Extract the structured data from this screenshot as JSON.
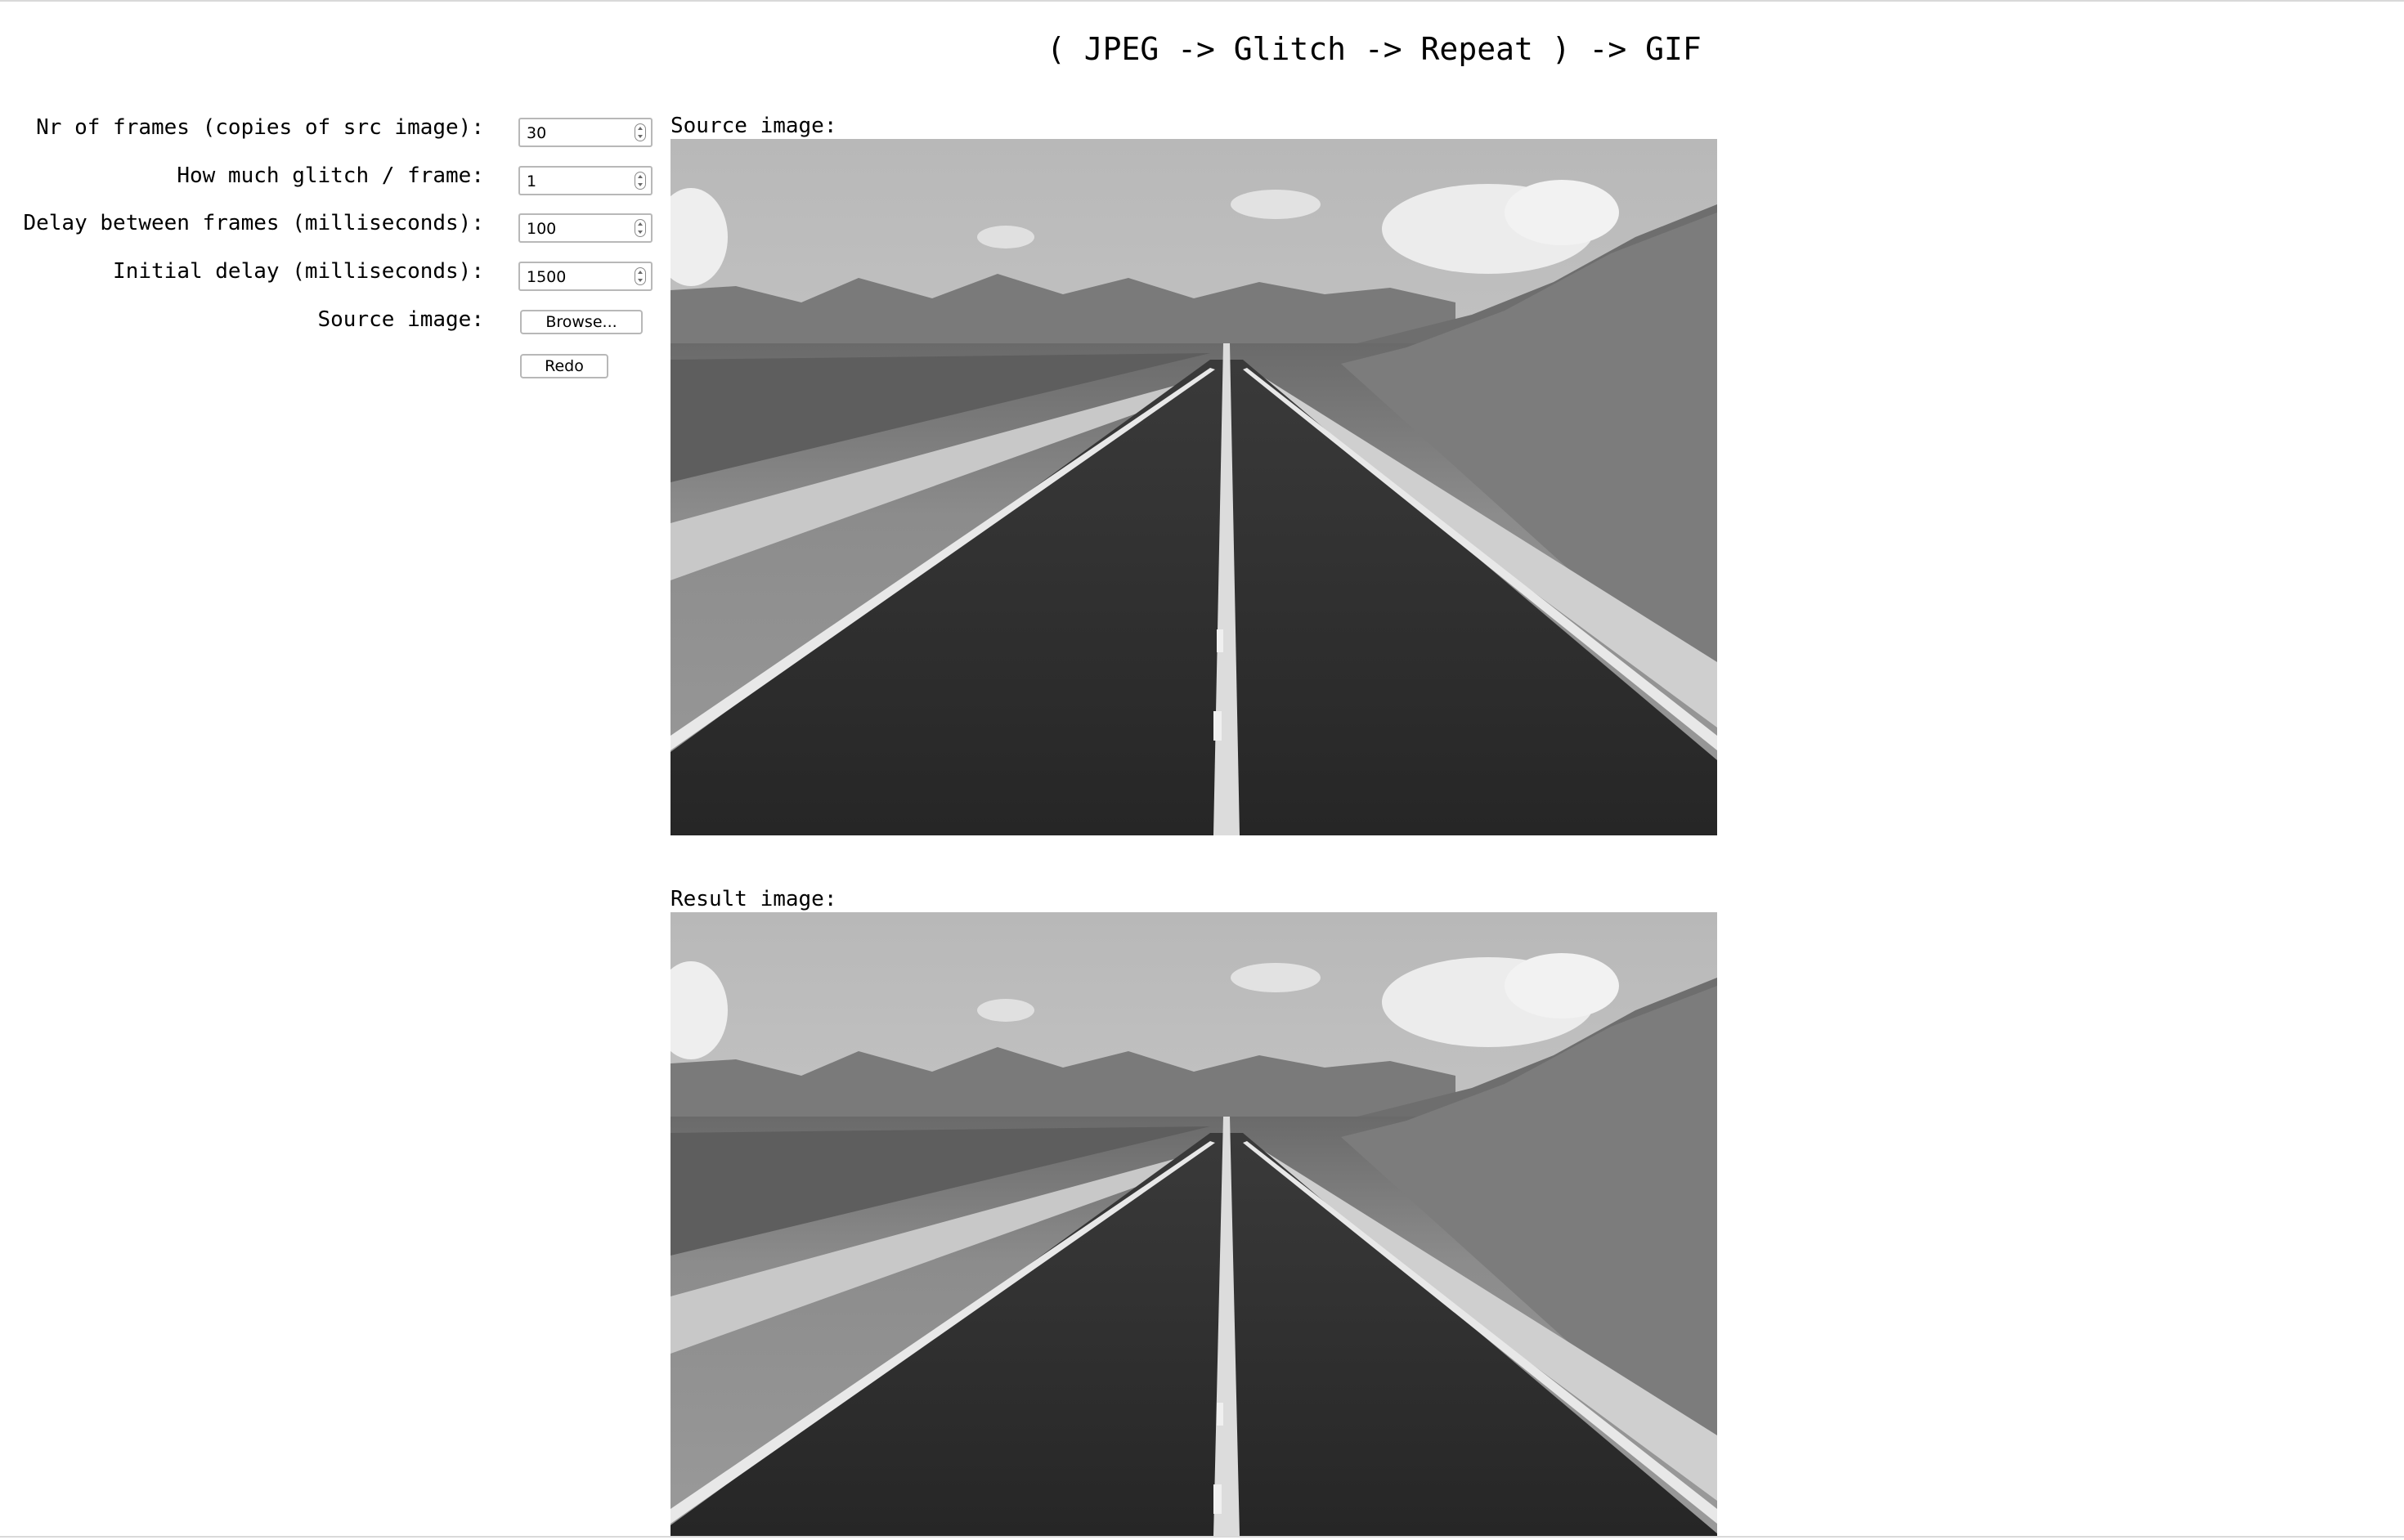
{
  "title": "( JPEG -> Glitch -> Repeat ) -> GIF",
  "form": {
    "frames": {
      "label": "Nr of frames (copies of src image):",
      "value": "30"
    },
    "glitch": {
      "label": "How much glitch / frame:",
      "value": "1"
    },
    "delay": {
      "label": "Delay between frames (milliseconds):",
      "value": "100"
    },
    "initial_delay": {
      "label": "Initial delay (milliseconds):",
      "value": "1500"
    },
    "source": {
      "label": "Source image:",
      "browse_label": "Browse..."
    },
    "redo_label": "Redo"
  },
  "images": {
    "source_label": "Source image:",
    "result_label": "Result image:",
    "photo_icon": "desert-road-photo"
  }
}
